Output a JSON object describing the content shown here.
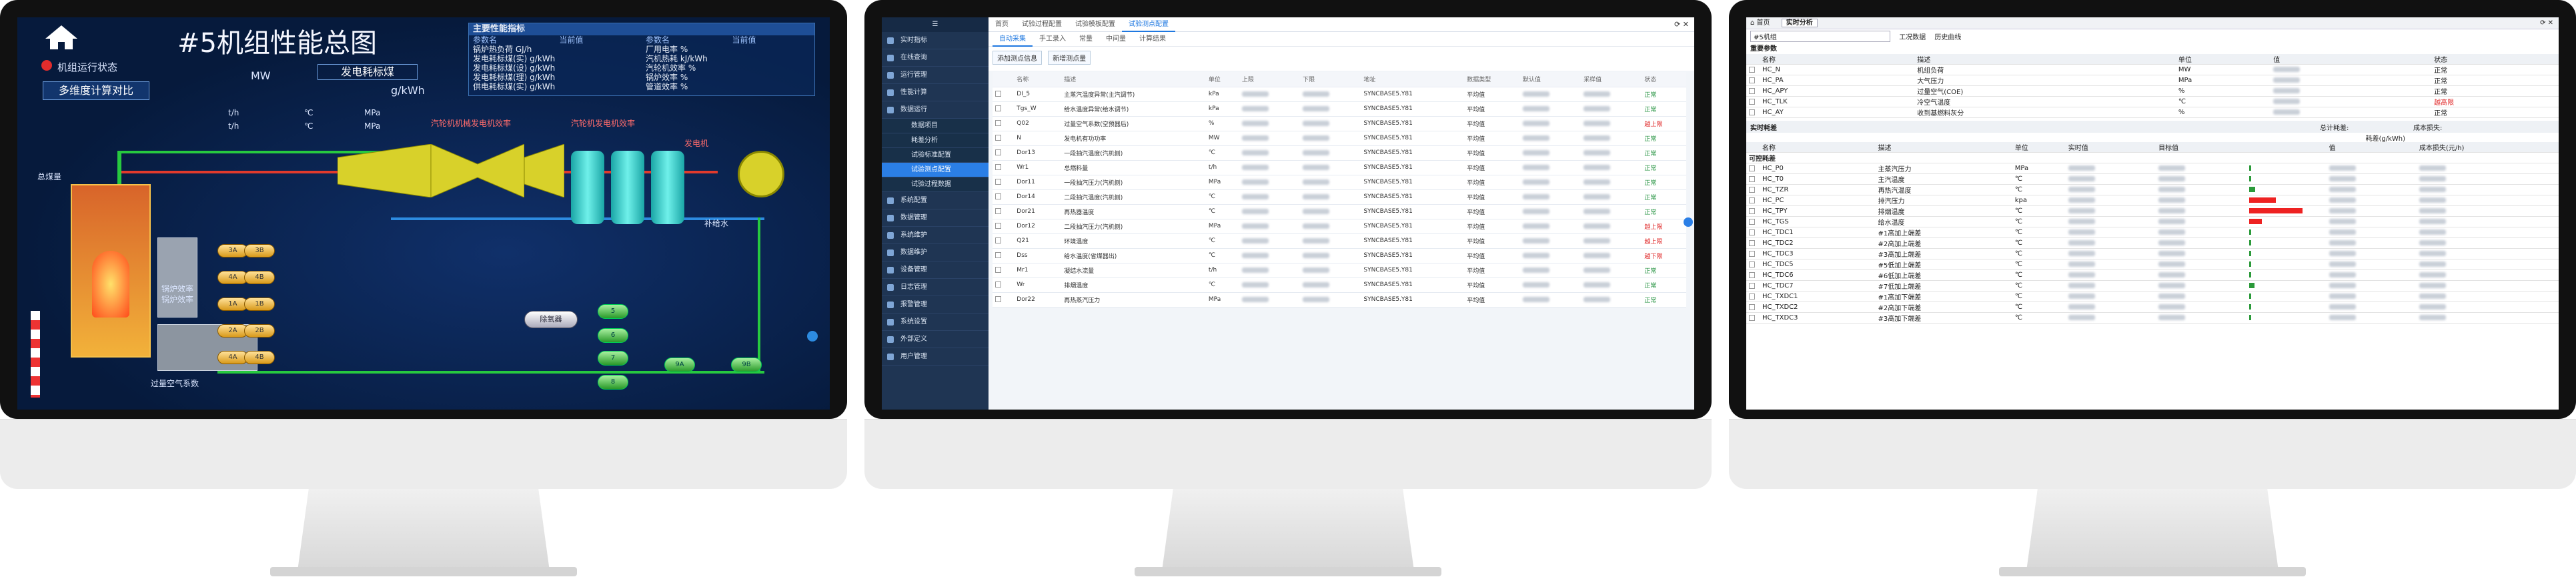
{
  "m1": {
    "title": "#5机组性能总图",
    "status_label": "机组运行状态",
    "compare_btn": "多维度计算对比",
    "coal_label": "发电耗标煤",
    "coal_unit": "g/kWh",
    "mw_unit": "MW",
    "panel": {
      "title": "主要性能指标",
      "cols": [
        "参数名",
        "当前值",
        "参数名",
        "当前值"
      ],
      "rows": [
        [
          "锅炉热负荷 GJ/h",
          "",
          "厂用电率 %",
          ""
        ],
        [
          "发电耗标煤(实) g/kWh",
          "",
          "汽机热耗 kJ/kWh",
          ""
        ],
        [
          "发电耗标煤(设) g/kWh",
          "",
          "汽轮机效率 %",
          ""
        ],
        [
          "发电耗标煤(理) g/kWh",
          "",
          "锅炉效率 %",
          ""
        ],
        [
          "供电耗标煤(实) g/kWh",
          "",
          "管道效率 %",
          ""
        ]
      ]
    },
    "units_row": [
      "t/h",
      "℃",
      "MPa",
      "t/h",
      "℃",
      "MPa"
    ],
    "labels": {
      "hp_eff": "汽轮机机械发电机效率",
      "gen_eff": "汽轮机发电机效率",
      "generator": "发电机",
      "makeup": "补给水",
      "deaerator": "除氧器",
      "boiler_eff": "锅炉效率",
      "boiler_eff2": "锅炉效率",
      "air_coef": "过量空气系数",
      "coal": "总煤量",
      "condenser": "凝汽器",
      "condensate": "凝水"
    },
    "heaters": [
      "3A",
      "3B",
      "4A",
      "4B",
      "1A",
      "1B",
      "2A",
      "2B",
      "4A",
      "4B"
    ],
    "lp_heaters": [
      "5",
      "6",
      "7",
      "8",
      "9A",
      "9B"
    ]
  },
  "m2": {
    "side": [
      "实时指标",
      "在线查询",
      "运行管理",
      "性能计算",
      "数据运行",
      "系统配置",
      "数据管理",
      "系统维护",
      "数据维护",
      "设备管理",
      "日志管理",
      "报警管理",
      "系统设置",
      "外部定义",
      "用户管理"
    ],
    "side_sub": [
      "数据项目",
      "耗差分析",
      "试验标准配置",
      "试验测点配置",
      "试验过程数据"
    ],
    "tabs": [
      "首页",
      "试验过程配置",
      "试验模板配置",
      "试验测点配置"
    ],
    "sub_tabs": [
      "自动采集",
      "手工录入",
      "常量",
      "中间量",
      "计算结果"
    ],
    "btns": [
      "添加测点信息",
      "新增测点量"
    ],
    "cols": [
      "名称",
      "描述",
      "单位",
      "上限",
      "下限",
      "地址",
      "数据类型",
      "默认值",
      "采样值",
      "状态"
    ],
    "rows": [
      [
        "DI_5",
        "主蒸汽温度异常(主汽调节)",
        "kPa",
        "SYNCBASE5.Y81",
        "平均值",
        "正常"
      ],
      [
        "Tgs_W",
        "给水温度异常(给水调节)",
        "kPa",
        "SYNCBASE5.Y81",
        "平均值",
        "正常"
      ],
      [
        "Q02",
        "过量空气系数(空预器后)",
        "%",
        "SYNCBASE5.Y81",
        "平均值",
        "越上限"
      ],
      [
        "N",
        "发电机有功功率",
        "MW",
        "SYNCBASE5.Y81",
        "平均值",
        "正常"
      ],
      [
        "Dor13",
        "一段抽汽温度(汽机侧)",
        "℃",
        "SYNCBASE5.Y81",
        "平均值",
        "正常"
      ],
      [
        "Wr1",
        "总燃料量",
        "t/h",
        "SYNCBASE5.Y81",
        "平均值",
        "正常"
      ],
      [
        "Dor11",
        "一段抽汽压力(汽机侧)",
        "MPa",
        "SYNCBASE5.Y81",
        "平均值",
        "正常"
      ],
      [
        "Dor14",
        "二段抽汽温度(汽机侧)",
        "℃",
        "SYNCBASE5.Y81",
        "平均值",
        "正常"
      ],
      [
        "Dor21",
        "再热器温度",
        "℃",
        "SYNCBASE5.Y81",
        "平均值",
        "正常"
      ],
      [
        "Dor12",
        "二段抽汽压力(汽机侧)",
        "MPa",
        "SYNCBASE5.Y81",
        "平均值",
        "越上限"
      ],
      [
        "Q21",
        "环境温度",
        "℃",
        "SYNCBASE5.Y81",
        "平均值",
        "越上限"
      ],
      [
        "Dss",
        "给水温度(省煤器出)",
        "℃",
        "SYNCBASE5.Y81",
        "平均值",
        "越下限"
      ],
      [
        "Mr1",
        "凝结水流量",
        "t/h",
        "SYNCBASE5.Y81",
        "平均值",
        "正常"
      ],
      [
        "Wr",
        "排烟温度",
        "℃",
        "SYNCBASE5.Y81",
        "平均值",
        "正常"
      ],
      [
        "Dor22",
        "再热蒸汽压力",
        "MPa",
        "SYNCBASE5.Y81",
        "平均值",
        "正常"
      ]
    ]
  },
  "m3": {
    "tabs": [
      "首页",
      "实时分析"
    ],
    "select": "#5机组",
    "btns": [
      "工况数据",
      "历史曲线"
    ],
    "sec1": "重要参数",
    "cols1": [
      "名称",
      "描述",
      "单位",
      "值",
      "状态"
    ],
    "rows1": [
      [
        "HC_N",
        "机组负荷",
        "MW",
        "正常"
      ],
      [
        "HC_PA",
        "大气压力",
        "MPa",
        "正常"
      ],
      [
        "HC_APY",
        "过量空气(COE)",
        "%",
        "正常"
      ],
      [
        "HC_TLK",
        "冷空气温度",
        "℃",
        "越高限"
      ],
      [
        "HC_AY",
        "收到基燃料灰分",
        "%",
        "正常"
      ]
    ],
    "sec2": "实时耗差",
    "summary": [
      "总计耗差:",
      "成本损失:"
    ],
    "sub_hdr": "耗差(g/kWh)",
    "cols2": [
      "名称",
      "描述",
      "单位",
      "实时值",
      "目标值",
      "",
      "值",
      "成本损失(元/h)"
    ],
    "group": "可控耗差",
    "rows2": [
      [
        "HC_P0",
        "主蒸汽压力",
        "MPa",
        0
      ],
      [
        "HC_T0",
        "主汽温度",
        "℃",
        0
      ],
      [
        "HC_TZR",
        "再热汽温度",
        "℃",
        0.06
      ],
      [
        "HC_PC",
        "排汽压力",
        "kpa",
        0.25
      ],
      [
        "HC_TPY",
        "排烟温度",
        "℃",
        0.5
      ],
      [
        "HC_TGS",
        "给水温度",
        "℃",
        0.12
      ],
      [
        "HC_TDC1",
        "#1高加上端差",
        "℃",
        0
      ],
      [
        "HC_TDC2",
        "#2高加上端差",
        "℃",
        0
      ],
      [
        "HC_TDC3",
        "#3高加上端差",
        "℃",
        0
      ],
      [
        "HC_TDC5",
        "#5低加上端差",
        "℃",
        0
      ],
      [
        "HC_TDC6",
        "#6低加上端差",
        "℃",
        0
      ],
      [
        "HC_TDC7",
        "#7低加上端差",
        "℃",
        0.05
      ],
      [
        "HC_TXDC1",
        "#1高加下端差",
        "℃",
        0
      ],
      [
        "HC_TXDC2",
        "#2高加下端差",
        "℃",
        0
      ],
      [
        "HC_TXDC3",
        "#3高加下端差",
        "℃",
        0
      ]
    ]
  }
}
